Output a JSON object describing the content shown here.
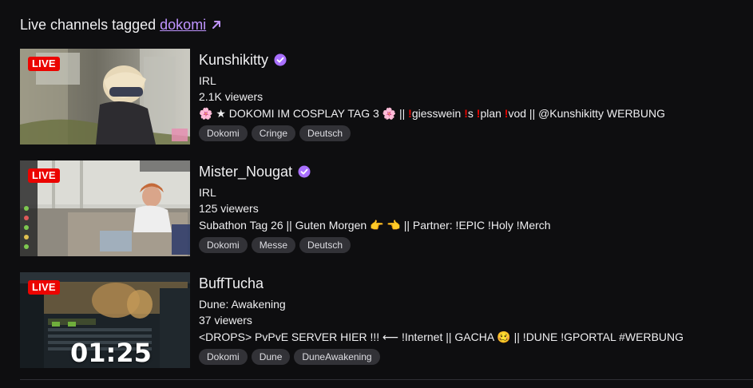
{
  "heading": {
    "prefix": "Live channels tagged",
    "tag": "dokomi"
  },
  "colors": {
    "background": "#0e0e10",
    "accent": "#bf94ff",
    "live_badge": "#eb0400",
    "tag_bg": "#323237"
  },
  "channels": [
    {
      "live_label": "LIVE",
      "name": "Kunshikitty",
      "verified": true,
      "category": "IRL",
      "viewers": "2.1K viewers",
      "title_parts": [
        "🌸 ★ DOKOMI IM COSPLAY TAG 3 🌸 || ",
        "!",
        "giesswein ",
        "!",
        "s ",
        "!",
        "plan ",
        "!",
        "vod || @Kunshikitty WERBUNG"
      ],
      "tags": [
        "Dokomi",
        "Cringe",
        "Deutsch"
      ]
    },
    {
      "live_label": "LIVE",
      "name": "Mister_Nougat",
      "verified": true,
      "category": "IRL",
      "viewers": "125 viewers",
      "title": "Subathon Tag 26 || Guten Morgen 👉 👈 || Partner: !EPIC !Holy !Merch",
      "tags": [
        "Dokomi",
        "Messe",
        "Deutsch"
      ]
    },
    {
      "live_label": "LIVE",
      "name": "BuffTucha",
      "verified": false,
      "category": "Dune: Awakening",
      "viewers": "37 viewers",
      "title": "<DROPS> PvPvE SERVER HIER !!! ⟵ !Internet || GACHA 🥴 || !DUNE !GPORTAL #WERBUNG",
      "tags": [
        "Dokomi",
        "Dune",
        "DuneAwakening"
      ],
      "timer": "01:25"
    }
  ]
}
